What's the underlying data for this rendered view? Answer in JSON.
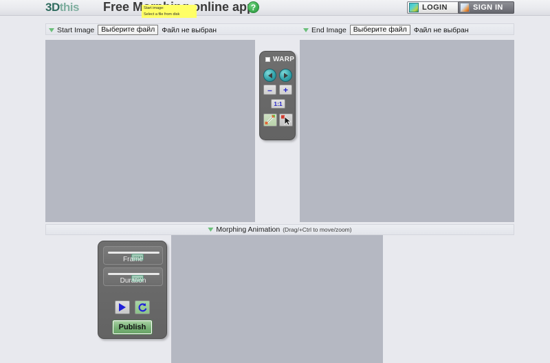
{
  "header": {
    "logo_primary": "3D",
    "logo_secondary": "this",
    "app_title": "Free Morphing online app",
    "help_icon_label": "?",
    "login_label": "LOGIN",
    "signin_label": "SIGN IN"
  },
  "tooltip": {
    "line1": "Start image:",
    "line2": "Select a file from disk"
  },
  "filebar": {
    "start": {
      "label": "Start Image",
      "choose_button": "Выберите файл",
      "status": "Файл не выбран"
    },
    "end": {
      "label": "End Image",
      "choose_button": "Выберите файл",
      "status": "Файл не выбран"
    }
  },
  "animation_strip": {
    "label": "Morphing Animation",
    "hint": "(Drag/+Ctrl to move/zoom)"
  },
  "warp_panel": {
    "title": "WARP",
    "zoom_out_label": "–",
    "zoom_in_label": "+",
    "fit_label": "1:1"
  },
  "anim_panel": {
    "frame_label": "Frame",
    "duration_label": "Duration",
    "publish_label": "Publish"
  },
  "colors": {
    "page_background": "#e8e9ee",
    "canvas_fill": "#b5b8c2",
    "panel_gray": "#6b6b6b",
    "accent_teal": "#35a5ac",
    "accent_green": "#79b277",
    "tooltip_yellow": "#ffff66",
    "logo_dark": "#2f6b5e",
    "logo_light": "#7fae9f"
  }
}
